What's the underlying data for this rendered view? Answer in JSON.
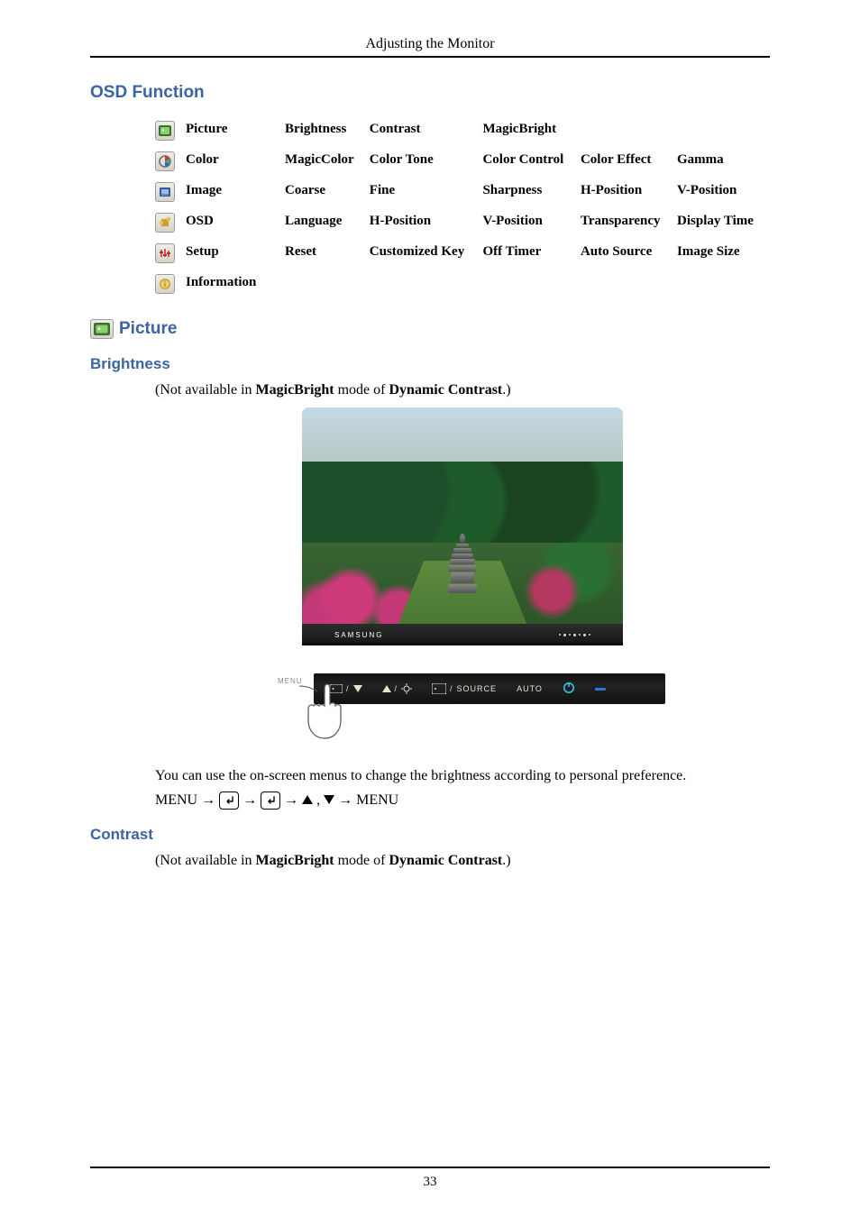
{
  "header": {
    "title": "Adjusting the Monitor"
  },
  "section": {
    "osd_function": "OSD Function",
    "picture_h1": "Picture",
    "brightness_h2": "Brightness",
    "contrast_h2": "Contrast"
  },
  "osd_rows": {
    "picture": {
      "label": "Picture",
      "c1": "Brightness",
      "c2": "Contrast",
      "c3": "MagicBright",
      "c4": "",
      "c5": ""
    },
    "color": {
      "label": "Color",
      "c1": "MagicColor",
      "c2": "Color Tone",
      "c3": "Color Control",
      "c4": "Color Effect",
      "c5": "Gamma"
    },
    "image": {
      "label": "Image",
      "c1": "Coarse",
      "c2": "Fine",
      "c3": "Sharpness",
      "c4": "H-Position",
      "c5": "V-Position"
    },
    "osd": {
      "label": "OSD",
      "c1": "Language",
      "c2": "H-Position",
      "c3": "V-Position",
      "c4": "Transparency",
      "c5": "Display Time"
    },
    "setup": {
      "label": "Setup",
      "c1": "Reset",
      "c2": "Customized Key",
      "c3": "Off Timer",
      "c4": "Auto Source",
      "c5": "Image Size"
    },
    "information": {
      "label": "Information"
    }
  },
  "brightness_block": {
    "not_available_prefix": "(Not available in ",
    "magicbright": "MagicBright",
    "mode_of": " mode of ",
    "dynamic_contrast": "Dynamic Contrast",
    "suffix": ".)",
    "samsung_label": "SAMSUNG",
    "body_text": "You can use the on-screen menus to change the brightness according to personal preference.",
    "menu_word": "MENU"
  },
  "contrast_block": {
    "not_available_prefix": "(Not available in ",
    "magicbright": "MagicBright",
    "mode_of": " mode of ",
    "dynamic_contrast": "Dynamic Contrast",
    "suffix": ".)"
  },
  "bezel": {
    "menu_label": "MENU",
    "source_label": "SOURCE",
    "auto_label": "AUTO"
  },
  "footer": {
    "page": "33"
  }
}
